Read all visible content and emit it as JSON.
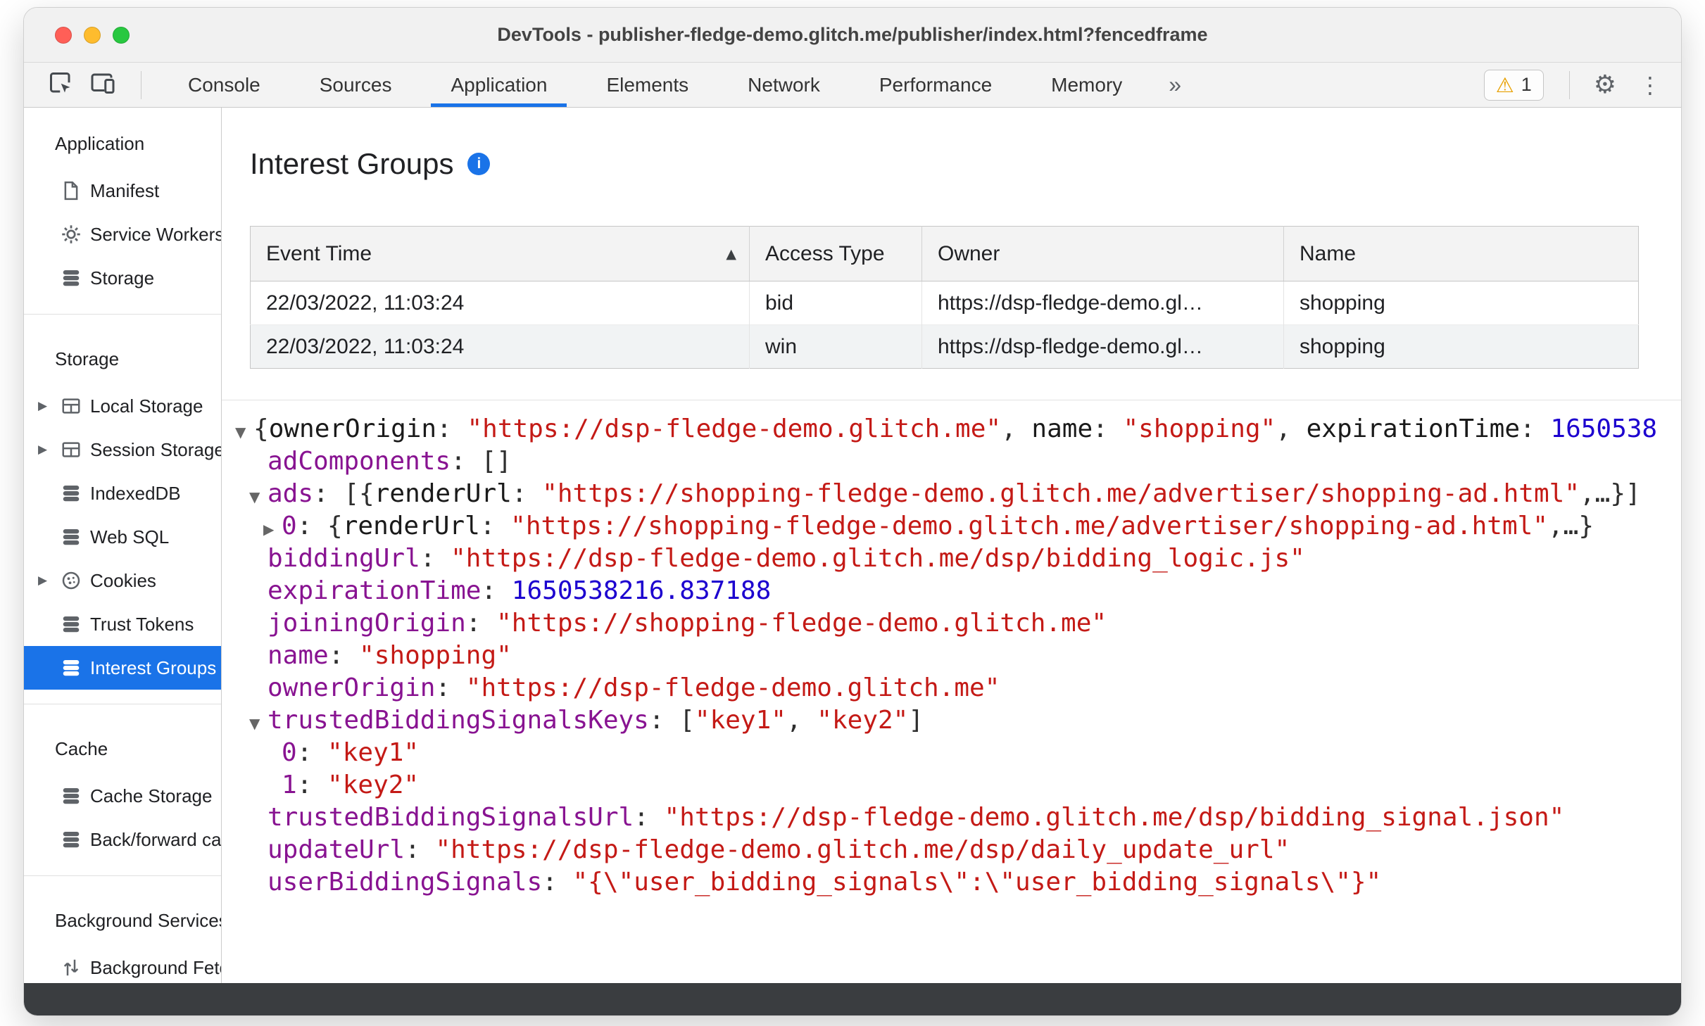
{
  "window": {
    "title": "DevTools - publisher-fledge-demo.glitch.me/publisher/index.html?fencedframe",
    "traffic_lights": [
      "#ff5f57",
      "#febc2e",
      "#28c840"
    ]
  },
  "icons": {
    "warning": "⚠",
    "gear": "⚙",
    "kebab": "⋮",
    "more_tabs": "»",
    "sort_ascending": "▲",
    "tree_expanded": "▼",
    "tree_collapsed": "▶",
    "info": "i"
  },
  "colors": {
    "accent_blue": "#1a73e8",
    "selected_item_bg": "#1a73e8",
    "key_purple": "#881391",
    "string_red": "#c41a16",
    "number_blue": "#1c00cf"
  },
  "toolbar": {
    "left_buttons": [
      {
        "icon": "inspect-element-icon"
      },
      {
        "icon": "device-toolbar-icon"
      }
    ],
    "tabs": [
      {
        "label": "Console",
        "active": false
      },
      {
        "label": "Sources",
        "active": false
      },
      {
        "label": "Application",
        "active": true
      },
      {
        "label": "Elements",
        "active": false
      },
      {
        "label": "Network",
        "active": false
      },
      {
        "label": "Performance",
        "active": false
      },
      {
        "label": "Memory",
        "active": false
      }
    ],
    "warning_count": "1",
    "right_buttons": [
      {
        "icon": "settings-gear-icon"
      },
      {
        "icon": "kebab-menu-icon"
      }
    ]
  },
  "sidebar": {
    "sections": [
      {
        "title": "Application",
        "items": [
          {
            "label": "Manifest",
            "icon": "manifest-icon"
          },
          {
            "label": "Service Workers",
            "icon": "gear-icon"
          },
          {
            "label": "Storage",
            "icon": "database-icon"
          }
        ]
      },
      {
        "title": "Storage",
        "items": [
          {
            "label": "Local Storage",
            "icon": "table-icon",
            "expandable": true
          },
          {
            "label": "Session Storage",
            "icon": "table-icon",
            "expandable": true
          },
          {
            "label": "IndexedDB",
            "icon": "database-icon"
          },
          {
            "label": "Web SQL",
            "icon": "database-icon"
          },
          {
            "label": "Cookies",
            "icon": "cookie-icon",
            "expandable": true
          },
          {
            "label": "Trust Tokens",
            "icon": "database-icon"
          },
          {
            "label": "Interest Groups",
            "icon": "database-icon",
            "selected": true
          }
        ]
      },
      {
        "title": "Cache",
        "items": [
          {
            "label": "Cache Storage",
            "icon": "database-icon"
          },
          {
            "label": "Back/forward cache",
            "icon": "database-icon"
          }
        ]
      },
      {
        "title": "Background Services",
        "items": [
          {
            "label": "Background Fetch",
            "icon": "fetch-arrows-icon"
          }
        ]
      }
    ]
  },
  "main": {
    "title": "Interest Groups",
    "table": {
      "columns": [
        "Event Time",
        "Access Type",
        "Owner",
        "Name"
      ],
      "sort": {
        "column": "Event Time",
        "direction": "ascending"
      },
      "rows": [
        [
          "22/03/2022, 11:03:24",
          "bid",
          "https://dsp-fledge-demo.gl…",
          "shopping"
        ],
        [
          "22/03/2022, 11:03:24",
          "win",
          "https://dsp-fledge-demo.gl…",
          "shopping"
        ]
      ]
    },
    "tree_lines": [
      {
        "indent": 0,
        "arrow": "down",
        "segments": [
          [
            "p",
            "{"
          ],
          [
            "pk",
            "ownerOrigin"
          ],
          [
            "p",
            ": "
          ],
          [
            "s",
            "\"https://dsp-fledge-demo.glitch.me\""
          ],
          [
            "p",
            ", "
          ],
          [
            "pk",
            "name"
          ],
          [
            "p",
            ": "
          ],
          [
            "s",
            "\"shopping\""
          ],
          [
            "p",
            ", "
          ],
          [
            "pk",
            "expirationTime"
          ],
          [
            "p",
            ": "
          ],
          [
            "n",
            "1650538"
          ]
        ]
      },
      {
        "indent": 1,
        "arrow": null,
        "segments": [
          [
            "k",
            "adComponents"
          ],
          [
            "p",
            ": []"
          ]
        ]
      },
      {
        "indent": 1,
        "arrow": "down",
        "segments": [
          [
            "k",
            "ads"
          ],
          [
            "p",
            ": [{"
          ],
          [
            "pk",
            "renderUrl"
          ],
          [
            "p",
            ": "
          ],
          [
            "s",
            "\"https://shopping-fledge-demo.glitch.me/advertiser/shopping-ad.html\""
          ],
          [
            "p",
            ",…}]"
          ]
        ]
      },
      {
        "indent": 2,
        "arrow": "right",
        "segments": [
          [
            "k",
            "0"
          ],
          [
            "p",
            ": {"
          ],
          [
            "pk",
            "renderUrl"
          ],
          [
            "p",
            ": "
          ],
          [
            "s",
            "\"https://shopping-fledge-demo.glitch.me/advertiser/shopping-ad.html\""
          ],
          [
            "p",
            ",…}"
          ]
        ]
      },
      {
        "indent": 1,
        "arrow": null,
        "segments": [
          [
            "k",
            "biddingUrl"
          ],
          [
            "p",
            ": "
          ],
          [
            "s",
            "\"https://dsp-fledge-demo.glitch.me/dsp/bidding_logic.js\""
          ]
        ]
      },
      {
        "indent": 1,
        "arrow": null,
        "segments": [
          [
            "k",
            "expirationTime"
          ],
          [
            "p",
            ": "
          ],
          [
            "n",
            "1650538216.837188"
          ]
        ]
      },
      {
        "indent": 1,
        "arrow": null,
        "segments": [
          [
            "k",
            "joiningOrigin"
          ],
          [
            "p",
            ": "
          ],
          [
            "s",
            "\"https://shopping-fledge-demo.glitch.me\""
          ]
        ]
      },
      {
        "indent": 1,
        "arrow": null,
        "segments": [
          [
            "k",
            "name"
          ],
          [
            "p",
            ": "
          ],
          [
            "s",
            "\"shopping\""
          ]
        ]
      },
      {
        "indent": 1,
        "arrow": null,
        "segments": [
          [
            "k",
            "ownerOrigin"
          ],
          [
            "p",
            ": "
          ],
          [
            "s",
            "\"https://dsp-fledge-demo.glitch.me\""
          ]
        ]
      },
      {
        "indent": 1,
        "arrow": "down",
        "segments": [
          [
            "k",
            "trustedBiddingSignalsKeys"
          ],
          [
            "p",
            ": ["
          ],
          [
            "s",
            "\"key1\""
          ],
          [
            "p",
            ", "
          ],
          [
            "s",
            "\"key2\""
          ],
          [
            "p",
            "]"
          ]
        ]
      },
      {
        "indent": 2,
        "arrow": null,
        "segments": [
          [
            "k",
            "0"
          ],
          [
            "p",
            ": "
          ],
          [
            "s",
            "\"key1\""
          ]
        ]
      },
      {
        "indent": 2,
        "arrow": null,
        "segments": [
          [
            "k",
            "1"
          ],
          [
            "p",
            ": "
          ],
          [
            "s",
            "\"key2\""
          ]
        ]
      },
      {
        "indent": 1,
        "arrow": null,
        "segments": [
          [
            "k",
            "trustedBiddingSignalsUrl"
          ],
          [
            "p",
            ": "
          ],
          [
            "s",
            "\"https://dsp-fledge-demo.glitch.me/dsp/bidding_signal.json\""
          ]
        ]
      },
      {
        "indent": 1,
        "arrow": null,
        "segments": [
          [
            "k",
            "updateUrl"
          ],
          [
            "p",
            ": "
          ],
          [
            "s",
            "\"https://dsp-fledge-demo.glitch.me/dsp/daily_update_url\""
          ]
        ]
      },
      {
        "indent": 1,
        "arrow": null,
        "segments": [
          [
            "k",
            "userBiddingSignals"
          ],
          [
            "p",
            ": "
          ],
          [
            "s",
            "\"{\\\"user_bidding_signals\\\":\\\"user_bidding_signals\\\"}\""
          ]
        ]
      }
    ]
  }
}
